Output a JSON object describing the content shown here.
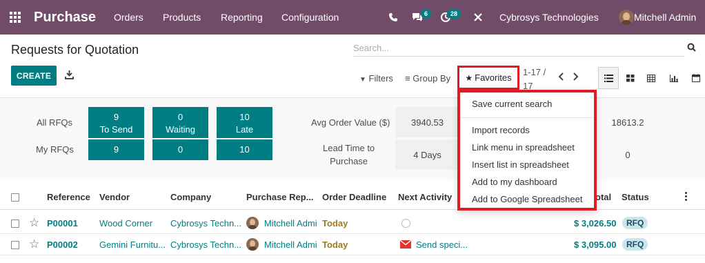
{
  "navbar": {
    "app_name": "Purchase",
    "menu": [
      "Orders",
      "Products",
      "Reporting",
      "Configuration"
    ],
    "chat_badge": "6",
    "activity_badge": "28",
    "company": "Cybrosys Technologies",
    "user": "Mitchell Admin"
  },
  "control_panel": {
    "title": "Requests for Quotation",
    "search_placeholder": "Search...",
    "create_label": "CREATE",
    "filters_label": "Filters",
    "groupby_label": "Group By",
    "favorites_label": "Favorites",
    "pager_value": "1-17 / 17"
  },
  "dashboard": {
    "all_rfqs_label": "All RFQs",
    "my_rfqs_label": "My RFQs",
    "tiles": [
      {
        "count": "9",
        "label": "To Send",
        "mine": "9"
      },
      {
        "count": "0",
        "label": "Waiting",
        "mine": "0"
      },
      {
        "count": "10",
        "label": "Late",
        "mine": "10"
      }
    ],
    "avg_order_label": "Avg Order Value ($)",
    "avg_order_value": "3940.53",
    "lead_time_label_1": "Lead Time to",
    "lead_time_label_2": "Purchase",
    "lead_time_value": "4 Days",
    "right_top_value": "18613.2",
    "right_bottom_value": "0"
  },
  "table": {
    "columns": [
      "Reference",
      "Vendor",
      "Company",
      "Purchase Rep...",
      "Order Deadline",
      "Next Activity",
      "otal",
      "Status"
    ],
    "rows": [
      {
        "reference": "P00001",
        "vendor": "Wood Corner",
        "company": "Cybrosys Techn...",
        "rep": "Mitchell Admi",
        "deadline": "Today",
        "activity": "",
        "total": "$ 3,026.50",
        "status": "RFQ"
      },
      {
        "reference": "P00002",
        "vendor": "Gemini Furnitu...",
        "company": "Cybrosys Techn...",
        "rep": "Mitchell Admi",
        "deadline": "Today",
        "activity": "Send speci...",
        "total": "$ 3,095.00",
        "status": "RFQ"
      }
    ]
  },
  "favorites_menu": {
    "save_search": "Save current search",
    "items": [
      "Import records",
      "Link menu in spreadsheet",
      "Insert list in spreadsheet",
      "Add to my dashboard",
      "Add to Google Spreadsheet"
    ]
  },
  "colors": {
    "navbar": "#714b67",
    "accent": "#017e84",
    "highlight_border": "#e01b24"
  },
  "icons": [
    "apps-grid-icon",
    "phone-icon",
    "chat-icon",
    "clock-icon",
    "tools-icon",
    "search-icon",
    "download-icon",
    "list-view-icon",
    "kanban-view-icon",
    "pivot-view-icon",
    "graph-view-icon",
    "calendar-view-icon",
    "star-icon",
    "mail-icon",
    "kebab-icon"
  ]
}
